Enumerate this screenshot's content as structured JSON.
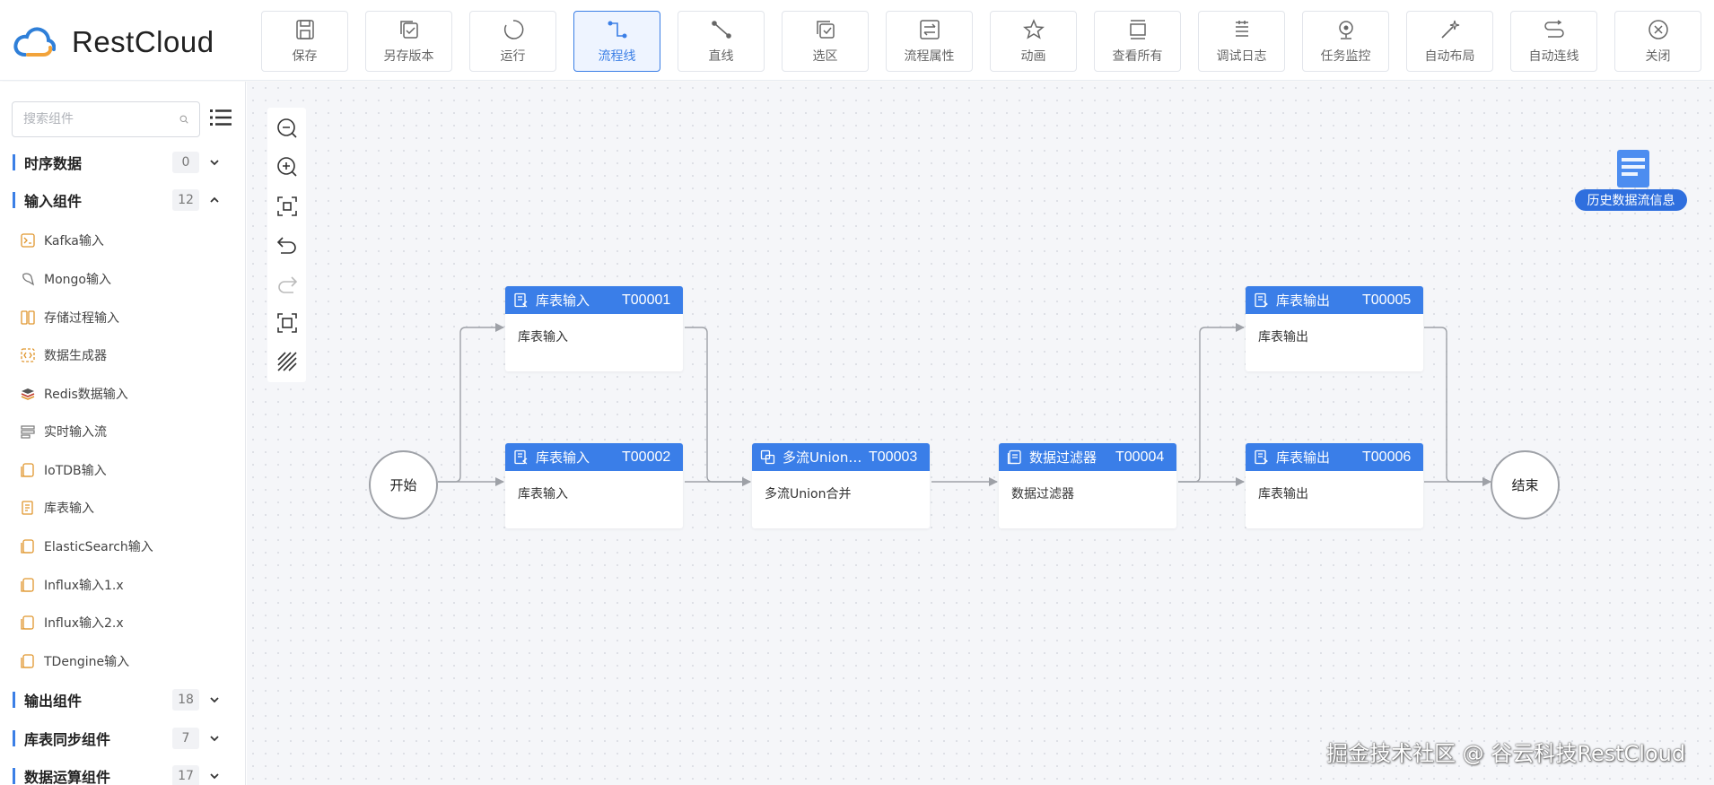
{
  "app": {
    "name": "RestCloud"
  },
  "toolbar": [
    {
      "label": "保存",
      "icon": "save-icon"
    },
    {
      "label": "另存版本",
      "icon": "save-version-icon"
    },
    {
      "label": "运行",
      "icon": "run-icon"
    },
    {
      "label": "流程线",
      "icon": "flow-line-icon",
      "active": true
    },
    {
      "label": "直线",
      "icon": "straight-line-icon"
    },
    {
      "label": "选区",
      "icon": "select-area-icon"
    },
    {
      "label": "流程属性",
      "icon": "flow-properties-icon"
    },
    {
      "label": "动画",
      "icon": "animation-icon"
    },
    {
      "label": "查看所有",
      "icon": "view-all-icon"
    },
    {
      "label": "调试日志",
      "icon": "debug-log-icon"
    },
    {
      "label": "任务监控",
      "icon": "task-monitor-icon"
    },
    {
      "label": "自动布局",
      "icon": "auto-layout-icon"
    },
    {
      "label": "自动连线",
      "icon": "auto-connect-icon"
    },
    {
      "label": "关闭",
      "icon": "close-icon"
    }
  ],
  "sidebar": {
    "search_placeholder": "搜索组件",
    "groups": [
      {
        "name": "时序数据",
        "count": "0",
        "expanded": false
      },
      {
        "name": "输入组件",
        "count": "12",
        "expanded": true
      },
      {
        "name": "输出组件",
        "count": "18",
        "expanded": false
      },
      {
        "name": "库表同步组件",
        "count": "7",
        "expanded": false
      },
      {
        "name": "数据运算组件",
        "count": "17",
        "expanded": false
      }
    ],
    "input_items": [
      {
        "label": "Kafka输入",
        "icon": "kafka-icon"
      },
      {
        "label": "Mongo输入",
        "icon": "mongo-icon"
      },
      {
        "label": "存储过程输入",
        "icon": "stored-procedure-icon"
      },
      {
        "label": "数据生成器",
        "icon": "data-generator-icon"
      },
      {
        "label": "Redis数据输入",
        "icon": "redis-icon"
      },
      {
        "label": "实时输入流",
        "icon": "realtime-stream-icon"
      },
      {
        "label": "IoTDB输入",
        "icon": "iotdb-icon"
      },
      {
        "label": "库表输入",
        "icon": "table-input-icon"
      },
      {
        "label": "ElasticSearch输入",
        "icon": "elasticsearch-icon"
      },
      {
        "label": "Influx输入1.x",
        "icon": "influx-icon"
      },
      {
        "label": "Influx输入2.x",
        "icon": "influx-icon"
      },
      {
        "label": "TDengine输入",
        "icon": "tdengine-icon"
      }
    ]
  },
  "history": {
    "label": "历史数据流信息"
  },
  "flow": {
    "start_label": "开始",
    "end_label": "结束",
    "nodes": [
      {
        "id": "T00001",
        "title": "库表输入",
        "body": "库表输入",
        "icon": "table-input-icon"
      },
      {
        "id": "T00002",
        "title": "库表输入",
        "body": "库表输入",
        "icon": "table-input-icon"
      },
      {
        "id": "T00003",
        "title": "多流Union…",
        "body": "多流Union合并",
        "icon": "union-icon"
      },
      {
        "id": "T00004",
        "title": "数据过滤器",
        "body": "数据过滤器",
        "icon": "filter-icon"
      },
      {
        "id": "T00005",
        "title": "库表输出",
        "body": "库表输出",
        "icon": "table-output-icon"
      },
      {
        "id": "T00006",
        "title": "库表输出",
        "body": "库表输出",
        "icon": "table-output-icon"
      }
    ]
  },
  "watermark": "掘金技术社区 @ 谷云科技RestCloud",
  "colors": {
    "accent": "#3a7ee8",
    "node_header": "#3a7ee8",
    "canvas_bg": "#f5f6f9",
    "edge": "#9ea1a7"
  }
}
